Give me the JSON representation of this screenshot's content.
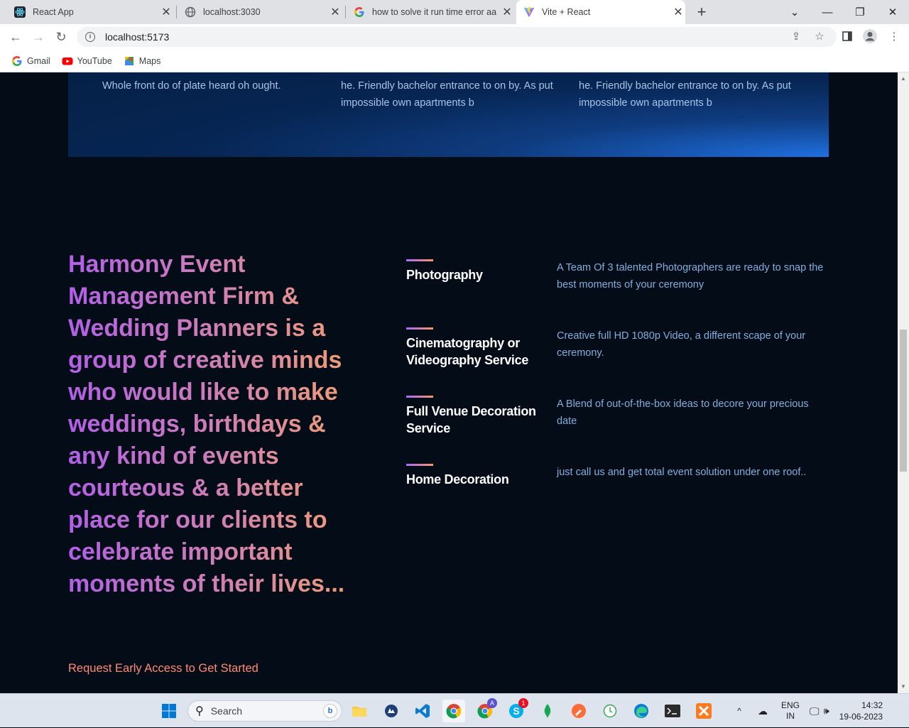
{
  "browser": {
    "tabs": [
      {
        "title": "React App",
        "icon": "react-icon"
      },
      {
        "title": "localhost:3030",
        "icon": "globe-icon"
      },
      {
        "title": "how to solve it run time error aa",
        "icon": "google-icon"
      },
      {
        "title": "Vite + React",
        "icon": "vite-icon",
        "active": true
      }
    ],
    "url": "localhost:5173",
    "bookmarks": [
      {
        "label": "Gmail",
        "icon": "google-icon"
      },
      {
        "label": "YouTube",
        "icon": "youtube-icon"
      },
      {
        "label": "Maps",
        "icon": "maps-icon"
      }
    ]
  },
  "page": {
    "band": {
      "col1": "Whole front do of plate heard oh ought.",
      "col2": "he. Friendly bachelor entrance to on by. As put impossible own apartments b",
      "col3": "he. Friendly bachelor entrance to on by. As put impossible own apartments b"
    },
    "headline": "Harmony Event Management Firm & Wedding Planners is a group of creative minds who would like to make weddings, birthdays & any kind of events courteous & a better place for our clients to celebrate important moments of their lives...",
    "cta": "Request Early Access to Get Started",
    "services": [
      {
        "name": "Photography",
        "desc": "A Team Of 3 talented Photographers are ready to snap the best moments of your ceremony"
      },
      {
        "name": "Cinematography or Videography Service",
        "desc": "Creative full HD 1080p Video, a different scape of your ceremony."
      },
      {
        "name": "Full Venue Decoration Service",
        "desc": "A Blend of out-of-the-box ideas to decore your precious date"
      },
      {
        "name": "Home Decoration",
        "desc": "just call us and get total event solution under one roof.."
      }
    ]
  },
  "taskbar": {
    "search_placeholder": "Search",
    "language": "ENG",
    "region": "IN",
    "time": "14:32",
    "date": "19-06-2023",
    "badge_skype": "1",
    "badge_chrome_profile": "A"
  },
  "colors": {
    "page_bg": "#040c18",
    "gradient_start": "#ae67fa",
    "gradient_end": "#f49867",
    "cta": "#ff8a71",
    "desc": "#81afdd"
  }
}
